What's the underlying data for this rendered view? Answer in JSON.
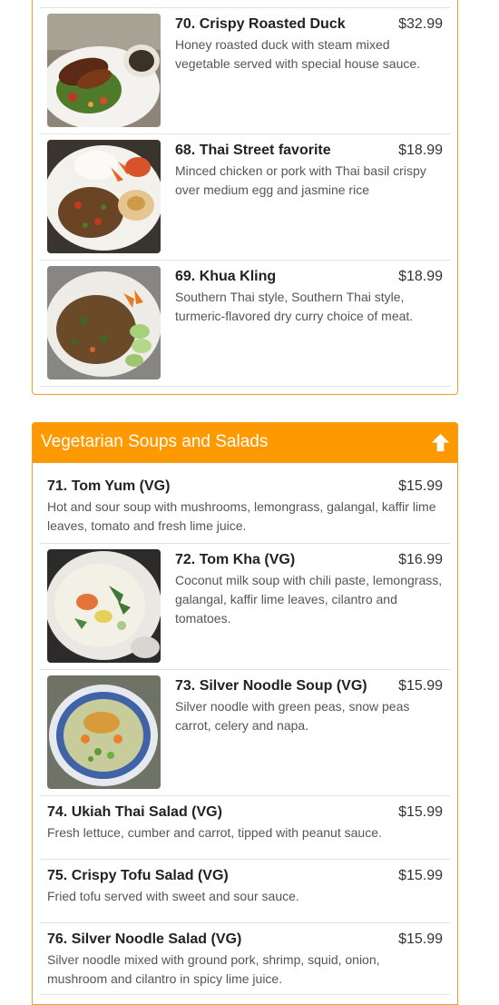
{
  "items_top": [
    {
      "name": "70. Crispy Roasted Duck",
      "price": "$32.99",
      "desc": "Honey roasted duck with steam mixed vegetable served with special house sauce.",
      "image": "crispy-duck-photo"
    },
    {
      "name": "68. Thai Street favorite",
      "price": "$18.99",
      "desc": "Minced chicken or pork with Thai basil crispy over medium egg and jasmine rice",
      "image": "thai-street-photo"
    },
    {
      "name": "69. Khua Kling",
      "price": "$18.99",
      "desc": "Southern Thai style, Southern Thai style, turmeric-flavored dry curry choice of meat.",
      "image": "khua-kling-photo"
    }
  ],
  "veg_section": {
    "title": "Vegetarian Soups and Salads",
    "icon": "arrow-up-icon",
    "items": [
      {
        "name": "71. Tom Yum (VG)",
        "price": "$15.99",
        "desc": "Hot and sour soup with mushrooms, lemongrass, galangal, kaffir lime leaves, tomato and fresh lime juice."
      },
      {
        "name": "72. Tom Kha (VG)",
        "price": "$16.99",
        "desc": "Coconut milk soup with chili paste, lemongrass, galangal, kaffir lime leaves, cilantro and tomatoes.",
        "image": "tom-kha-photo"
      },
      {
        "name": "73. Silver Noodle Soup (VG)",
        "price": "$15.99",
        "desc": "Silver noodle with green peas, snow peas carrot, celery and napa.",
        "image": "silver-noodle-soup-photo"
      },
      {
        "name": "74. Ukiah Thai Salad (VG)",
        "price": "$15.99",
        "desc": "Fresh lettuce, cumber and carrot, tipped with peanut sauce."
      },
      {
        "name": "75. Crispy Tofu Salad (VG)",
        "price": "$15.99",
        "desc": "Fried tofu served with sweet and sour sauce."
      },
      {
        "name": "76. Silver Noodle Salad (VG)",
        "price": "$15.99",
        "desc": "Silver noodle mixed with ground pork, shrimp, squid, onion, mushroom and cilantro in spicy lime juice."
      }
    ]
  },
  "colors": {
    "accent": "#ff9900",
    "border": "#f0a020"
  }
}
